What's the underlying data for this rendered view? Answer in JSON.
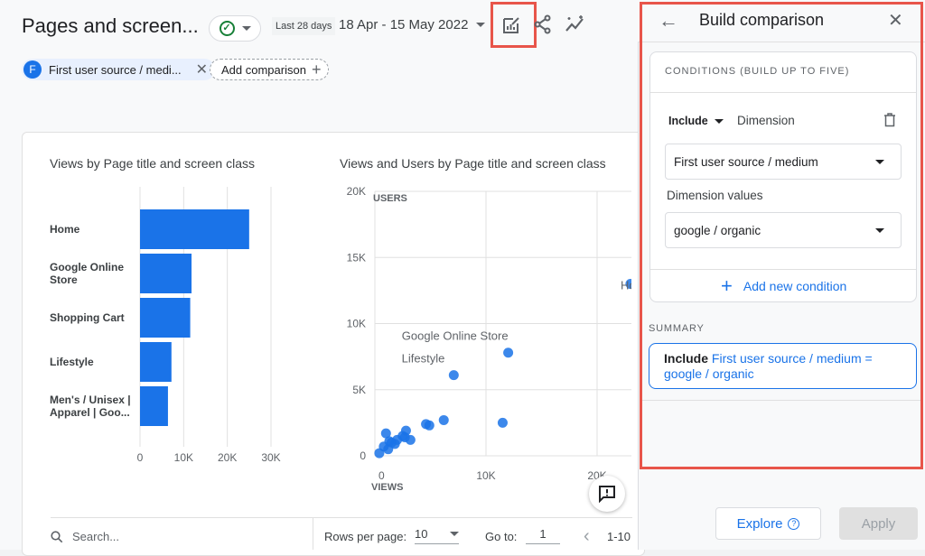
{
  "header": {
    "title": "Pages and screen...",
    "date_preset": "Last 28 days",
    "date_range": "18 Apr - 15 May 2022"
  },
  "comparison_chip": {
    "letter": "F",
    "label": "First user source / medi..."
  },
  "add_comparison": "Add comparison",
  "icons": [
    "check-circle-icon",
    "customize-report-icon",
    "share-icon",
    "insights-icon",
    "close-icon",
    "plus-icon",
    "feedback-icon",
    "search-icon",
    "arrow-left-icon",
    "delete-icon"
  ],
  "colors": {
    "accent": "#1a73e8",
    "bar": "#1a73e8",
    "highlight": "#e8554a"
  },
  "chart_data": [
    {
      "type": "bar",
      "title": "Views by Page title and screen class",
      "orientation": "horizontal",
      "categories": [
        "Home",
        "Google Online Store",
        "Shopping Cart",
        "Lifestyle",
        "Men's / Unisex | Apparel | Goo..."
      ],
      "category_lines": [
        [
          "Home"
        ],
        [
          "Google Online",
          "Store"
        ],
        [
          "Shopping Cart"
        ],
        [
          "Lifestyle"
        ],
        [
          "Men's / Unisex |",
          "Apparel | Goo..."
        ]
      ],
      "values": [
        25000,
        11800,
        11500,
        7200,
        6400
      ],
      "xlim": [
        0,
        30000
      ],
      "ticks": [
        "0",
        "10K",
        "20K",
        "30K"
      ],
      "tick_values": [
        0,
        10000,
        20000,
        30000
      ],
      "grid": true
    },
    {
      "type": "scatter",
      "title": "Views and Users by Page title and screen class",
      "xlabel": "VIEWS",
      "ylabel": "USERS",
      "xlim": [
        0,
        22500
      ],
      "ylim": [
        0,
        20000
      ],
      "xticks": [
        "0",
        "10K",
        "20K"
      ],
      "xtick_values": [
        0,
        10000,
        20000
      ],
      "yticks": [
        "0",
        "5K",
        "10K",
        "15K",
        "20K"
      ],
      "ytick_values": [
        0,
        5000,
        10000,
        15000,
        20000
      ],
      "grid": true,
      "points": [
        {
          "x": 7100,
          "y": 6100,
          "label": "Lifestyle"
        },
        {
          "x": 12000,
          "y": 7800,
          "label": "Google Online Store"
        },
        {
          "x": 23000,
          "y": 13000,
          "label": "Ho"
        },
        {
          "x": 11500,
          "y": 2500
        },
        {
          "x": 6200,
          "y": 2700
        },
        {
          "x": 4600,
          "y": 2400
        },
        {
          "x": 4900,
          "y": 2300
        },
        {
          "x": 1000,
          "y": 1700
        },
        {
          "x": 2800,
          "y": 1900
        },
        {
          "x": 2700,
          "y": 1400
        },
        {
          "x": 3200,
          "y": 1200
        },
        {
          "x": 1500,
          "y": 1000
        },
        {
          "x": 2000,
          "y": 1200
        },
        {
          "x": 800,
          "y": 700
        },
        {
          "x": 400,
          "y": 200
        },
        {
          "x": 1200,
          "y": 500
        },
        {
          "x": 1800,
          "y": 900
        },
        {
          "x": 2500,
          "y": 1500
        },
        {
          "x": 1300,
          "y": 1100
        }
      ]
    }
  ],
  "table_footer": {
    "search_placeholder": "Search...",
    "rows_per_page_label": "Rows per page:",
    "rows_per_page": "10",
    "goto_label": "Go to:",
    "goto_value": "1",
    "range": "1-10"
  },
  "panel": {
    "title": "Build comparison",
    "conditions_heading": "CONDITIONS (BUILD UP TO FIVE)",
    "include": "Include",
    "dimension_label": "Dimension",
    "dimension_value": "First user source / medium",
    "dimension_values_label": "Dimension values",
    "dimension_values_value": "google / organic",
    "add_condition": "Add new condition",
    "summary_heading": "SUMMARY",
    "summary_include": "Include",
    "summary_text": "First user source / medium = google / organic",
    "explore": "Explore",
    "apply": "Apply"
  }
}
